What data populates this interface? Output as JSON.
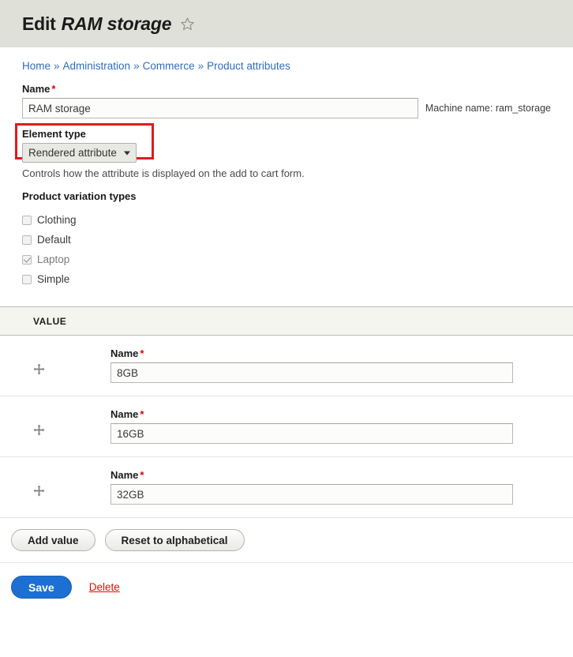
{
  "header": {
    "title_prefix": "Edit",
    "title_entity": "RAM storage",
    "star_icon": "star-outline-icon"
  },
  "breadcrumb": {
    "separator": "»",
    "items": [
      {
        "label": "Home"
      },
      {
        "label": "Administration"
      },
      {
        "label": "Commerce"
      },
      {
        "label": "Product attributes"
      }
    ]
  },
  "form": {
    "name": {
      "label": "Name",
      "required_mark": "*",
      "value": "RAM storage",
      "placeholder": "",
      "machine_name": "Machine name: ram_storage"
    },
    "element_type": {
      "label": "Element type",
      "required_mark": "",
      "selected": "Rendered attribute",
      "options": [
        "Rendered attribute"
      ],
      "description": "Controls how the attribute is displayed on the add to cart form.",
      "highlight_color": "#e01b1b"
    },
    "product_variation_types": {
      "label": "Product variation types",
      "items": [
        {
          "label": "Clothing",
          "checked": false,
          "disabled": false
        },
        {
          "label": "Default",
          "checked": false,
          "disabled": false
        },
        {
          "label": "Laptop",
          "checked": true,
          "disabled": true
        },
        {
          "label": "Simple",
          "checked": false,
          "disabled": false
        }
      ]
    }
  },
  "value_table": {
    "column_header": "VALUE",
    "drag_icon": "move-handle-icon",
    "rows": [
      {
        "name_label": "Name",
        "required_mark": "*",
        "value": "8GB"
      },
      {
        "name_label": "Name",
        "required_mark": "*",
        "value": "16GB"
      },
      {
        "name_label": "Name",
        "required_mark": "*",
        "value": "32GB"
      }
    ]
  },
  "actions": {
    "add_value": "Add value",
    "reset_alphabetical": "Reset to alphabetical",
    "save": "Save",
    "delete": "Delete",
    "save_color": "#1d6fd4",
    "delete_color": "#e00b0b"
  }
}
